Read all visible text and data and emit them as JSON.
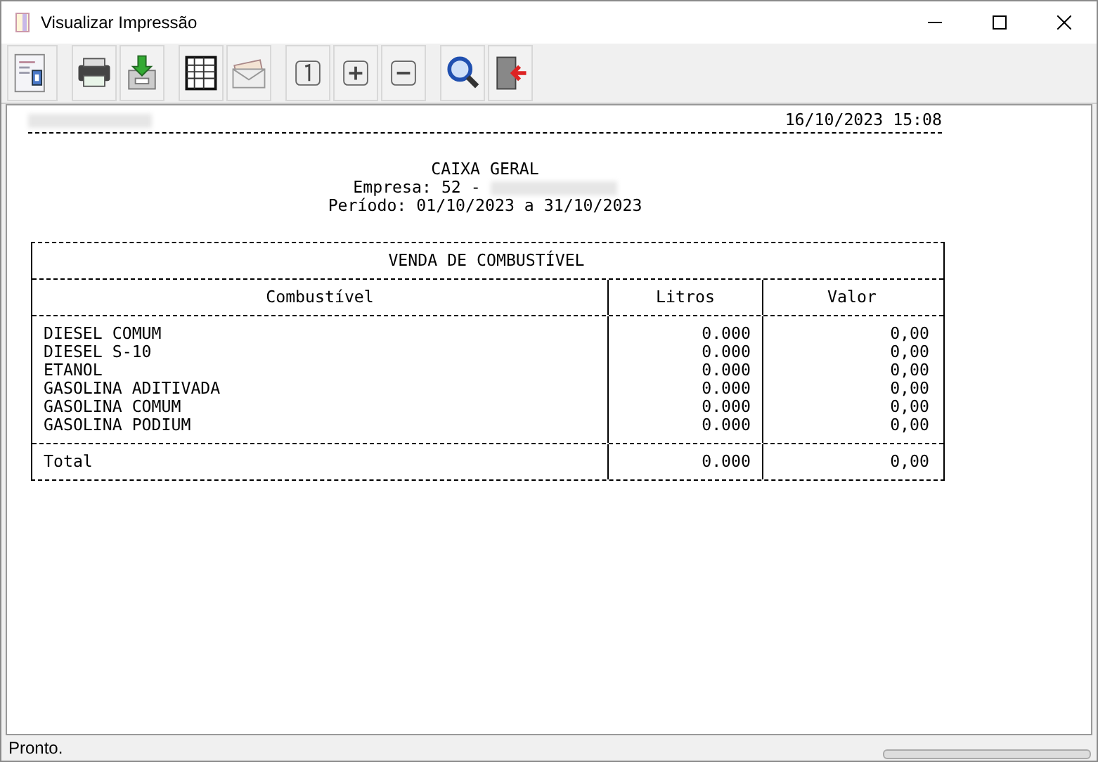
{
  "window": {
    "title": "Visualizar Impressão"
  },
  "report": {
    "datetime": "16/10/2023 15:08",
    "title": "CAIXA GERAL",
    "company_label": "Empresa: 52 -",
    "period": "Período: 01/10/2023 a 31/10/2023",
    "table": {
      "title": "VENDA DE COMBUSTÍVEL",
      "columns": [
        "Combustível",
        "Litros",
        "Valor"
      ],
      "rows": [
        {
          "name": "DIESEL COMUM",
          "litros": "0.000",
          "valor": "0,00"
        },
        {
          "name": "DIESEL S-10",
          "litros": "0.000",
          "valor": "0,00"
        },
        {
          "name": "ETANOL",
          "litros": "0.000",
          "valor": "0,00"
        },
        {
          "name": "GASOLINA ADITIVADA",
          "litros": "0.000",
          "valor": "0,00"
        },
        {
          "name": "GASOLINA COMUM",
          "litros": "0.000",
          "valor": "0,00"
        },
        {
          "name": "GASOLINA PODIUM",
          "litros": "0.000",
          "valor": "0,00"
        }
      ],
      "total": {
        "name": "Total",
        "litros": "0.000",
        "valor": "0,00"
      }
    }
  },
  "status_bar": {
    "text": "Pronto."
  }
}
